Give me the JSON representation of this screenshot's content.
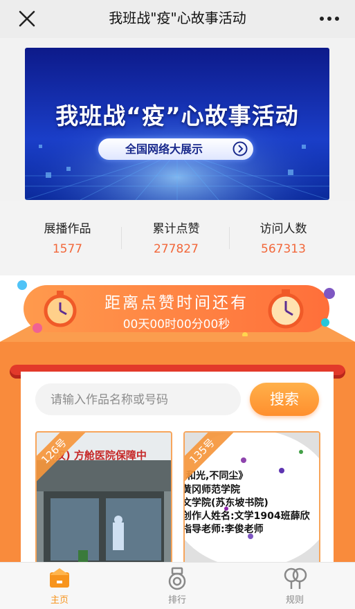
{
  "nav": {
    "title": "我班战\"疫\"心故事活动",
    "close_icon": "close-icon",
    "more_icon": "more-icon"
  },
  "banner": {
    "title": "我班战“疫”心故事活动",
    "button_label": "全国网络大展示"
  },
  "stats": [
    {
      "label": "展播作品",
      "value": "1577"
    },
    {
      "label": "累计点赞",
      "value": "277827"
    },
    {
      "label": "访问人数",
      "value": "567313"
    }
  ],
  "countdown": {
    "title": "距离点赞时间还有",
    "time": "00天00时00分00秒"
  },
  "search": {
    "placeholder": "请输入作品名称或号码",
    "button_label": "搜索"
  },
  "works": [
    {
      "number": "126号",
      "caption": "(汉) 方舱医院保障中"
    },
    {
      "number": "135号",
      "lines": [
        "和光,不同尘》",
        "黄冈师范学院",
        "文学院(苏东坡书院)",
        "创作人姓名:文学1904班薛欣",
        "指导老师:李俊老师"
      ]
    }
  ],
  "tabs": [
    {
      "label": "主页",
      "icon": "home-icon",
      "active": true
    },
    {
      "label": "排行",
      "icon": "medal-icon",
      "active": false
    },
    {
      "label": "规则",
      "icon": "rules-icon",
      "active": false
    }
  ],
  "colors": {
    "accent": "#f2673a",
    "orange": "#f98b3c",
    "tab_active": "#f7941d",
    "tab_inactive": "#888888"
  }
}
